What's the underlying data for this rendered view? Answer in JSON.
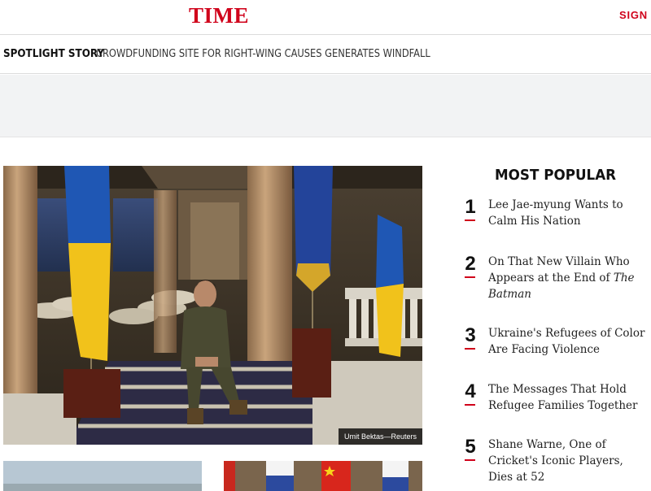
{
  "header": {
    "logo": "TIME",
    "signin": "SIGN I"
  },
  "spotlight": {
    "label": "SPOTLIGHT STORY",
    "headline": "CROWDFUNDING SITE FOR RIGHT-WING CAUSES GENERATES WINDFALL"
  },
  "hero": {
    "credit": "Umit Bektas—Reuters"
  },
  "most_popular": {
    "title": "MOST POPULAR",
    "items": [
      {
        "num": "1",
        "text": "Lee Jae-myung Wants to Calm His Nation"
      },
      {
        "num": "2",
        "text": "On That New Villain Who Appears at the End of ",
        "em": "The Batman"
      },
      {
        "num": "3",
        "text": "Ukraine's Refugees of Color Are Facing Violence"
      },
      {
        "num": "4",
        "text": "The Messages That Hold Refugee Families Together"
      },
      {
        "num": "5",
        "text": "Shane Warne, One of Cricket's Iconic Players, Dies at 52"
      }
    ]
  },
  "colors": {
    "brand_red": "#d0021b",
    "ad_band": "#f2f3f4"
  }
}
